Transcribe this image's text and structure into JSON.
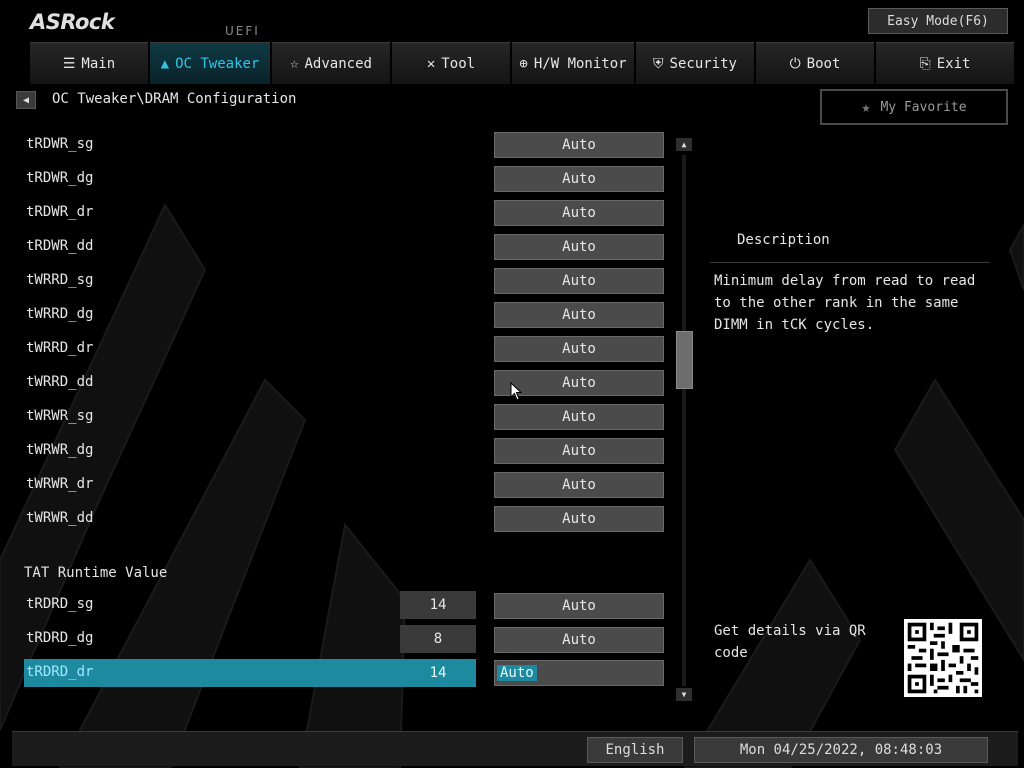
{
  "header": {
    "logo": "ASRock",
    "uefi": "UEFI",
    "easy_mode": "Easy Mode(F6)"
  },
  "tabs": [
    {
      "label": "Main",
      "icon": "list-icon",
      "active": false
    },
    {
      "label": "OC Tweaker",
      "icon": "rocket-icon",
      "active": true
    },
    {
      "label": "Advanced",
      "icon": "star-icon",
      "active": false
    },
    {
      "label": "Tool",
      "icon": "tools-icon",
      "active": false
    },
    {
      "label": "H/W Monitor",
      "icon": "monitor-icon",
      "active": false
    },
    {
      "label": "Security",
      "icon": "shield-icon",
      "active": false
    },
    {
      "label": "Boot",
      "icon": "power-icon",
      "active": false
    },
    {
      "label": "Exit",
      "icon": "exit-icon",
      "active": false
    }
  ],
  "breadcrumb": "OC Tweaker\\DRAM Configuration",
  "favorite": "My Favorite",
  "settings": [
    {
      "label": "tRDWR_sg",
      "value": "Auto"
    },
    {
      "label": "tRDWR_dg",
      "value": "Auto"
    },
    {
      "label": "tRDWR_dr",
      "value": "Auto"
    },
    {
      "label": "tRDWR_dd",
      "value": "Auto"
    },
    {
      "label": "tWRRD_sg",
      "value": "Auto"
    },
    {
      "label": "tWRRD_dg",
      "value": "Auto"
    },
    {
      "label": "tWRRD_dr",
      "value": "Auto"
    },
    {
      "label": "tWRRD_dd",
      "value": "Auto"
    },
    {
      "label": "tWRWR_sg",
      "value": "Auto"
    },
    {
      "label": "tWRWR_dg",
      "value": "Auto"
    },
    {
      "label": "tWRWR_dr",
      "value": "Auto"
    },
    {
      "label": "tWRWR_dd",
      "value": "Auto"
    }
  ],
  "section_title": "TAT Runtime Value",
  "runtime": [
    {
      "label": "tRDRD_sg",
      "current": "14",
      "value": "Auto",
      "selected": false
    },
    {
      "label": "tRDRD_dg",
      "current": "8",
      "value": "Auto",
      "selected": false
    },
    {
      "label": "tRDRD_dr",
      "current": "14",
      "value": "Auto",
      "selected": true
    }
  ],
  "description": {
    "title": "Description",
    "text": "Minimum delay from read to read to the other rank in the same DIMM in tCK cycles."
  },
  "qr": {
    "text": "Get details via QR code"
  },
  "footer": {
    "language": "English",
    "datetime": "Mon 04/25/2022, 08:48:03"
  },
  "colors": {
    "accent": "#1d8aa0",
    "active_tab_text": "#2fc4e6",
    "value_box": "#4b4b4b"
  }
}
